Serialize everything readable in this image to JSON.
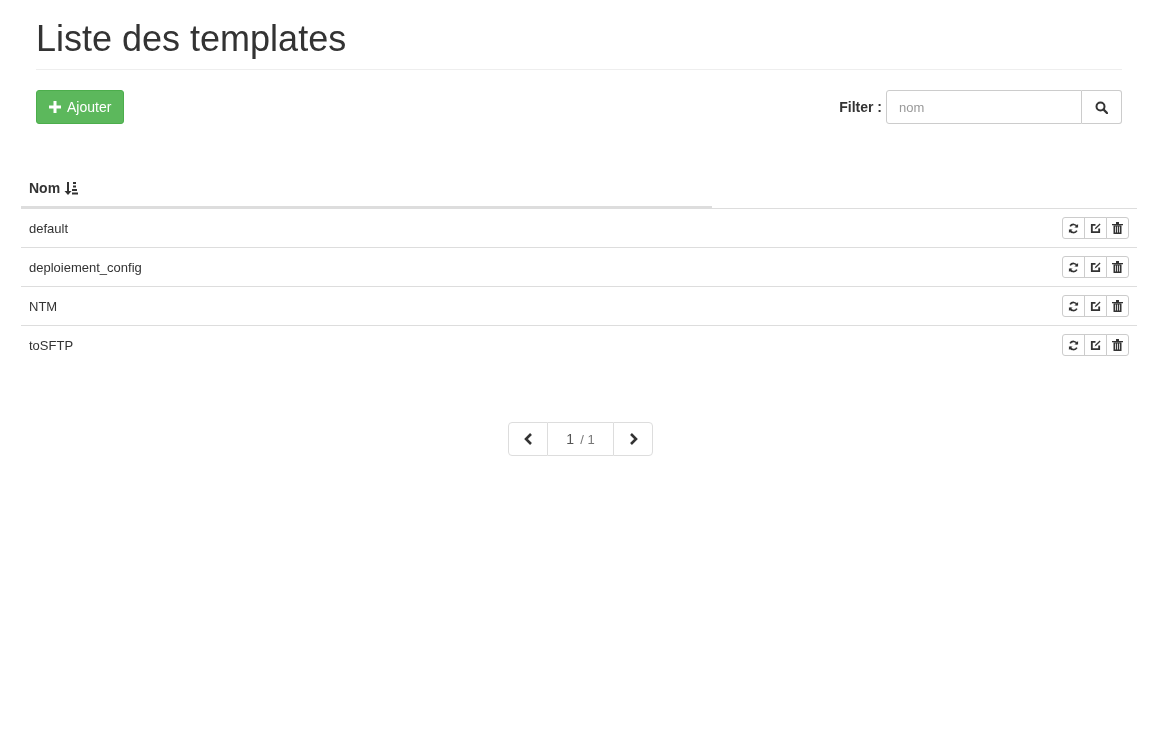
{
  "page_title": "Liste des templates",
  "add_button": {
    "label": "Ajouter"
  },
  "filter": {
    "label": "Filter :",
    "placeholder": "nom"
  },
  "table": {
    "columns": [
      {
        "label": "Nom"
      }
    ],
    "rows": [
      {
        "name": "default"
      },
      {
        "name": "deploiement_config"
      },
      {
        "name": "NTM"
      },
      {
        "name": "toSFTP"
      }
    ]
  },
  "pagination": {
    "current": "1",
    "total": "/ 1"
  }
}
